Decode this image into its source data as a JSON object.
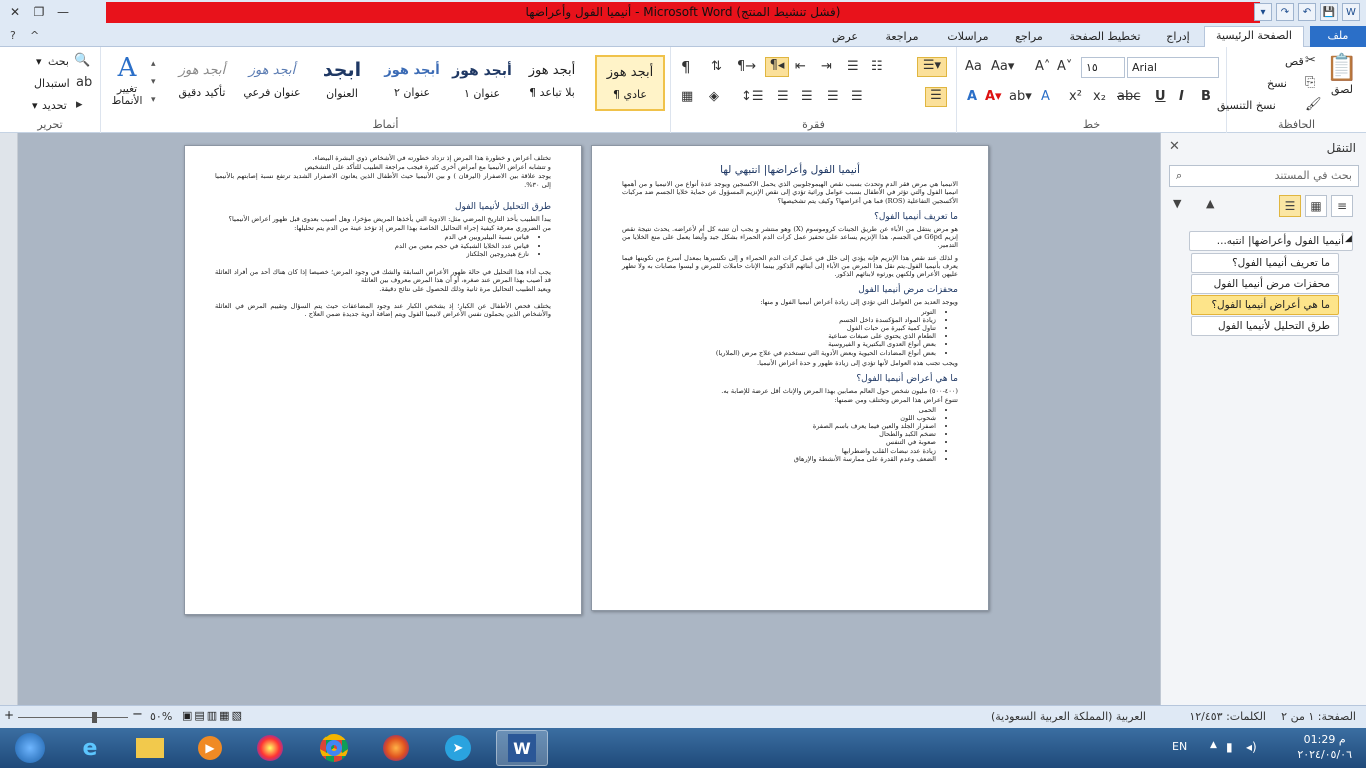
{
  "window": {
    "title": "أنيميا الفول وأعراضها - Microsoft Word (فشل تنشيط المنتج)",
    "controls": {
      "close": "✕",
      "restore": "❐",
      "minimize": "—"
    },
    "qat": [
      "W",
      "💾",
      "↶",
      "↷",
      "▾"
    ]
  },
  "tabs": {
    "file": "ملف",
    "home": "الصفحة الرئيسية",
    "insert": "إدراج",
    "layout": "تخطيط الصفحة",
    "references": "مراجع",
    "mailings": "مراسلات",
    "review": "مراجعة",
    "view": "عرض"
  },
  "ribbon": {
    "clipboard": {
      "label": "الحافظة",
      "paste": "لصق",
      "cut": "قص",
      "copy": "نسخ",
      "format_painter": "نسخ التنسيق"
    },
    "font": {
      "label": "خط",
      "name": "Arial",
      "size": "١٥"
    },
    "paragraph": {
      "label": "فقرة"
    },
    "styles": {
      "label": "أنماط",
      "items": [
        {
          "sample": "أبجد هوز",
          "name": "¶ عادي"
        },
        {
          "sample": "أبجد هوز",
          "name": "¶ بلا تباعد"
        },
        {
          "sample": "أبجد هوز",
          "name": "عنوان ١"
        },
        {
          "sample": "أبجد هوز",
          "name": "عنوان ٢"
        },
        {
          "sample": "ابجد",
          "name": "العنوان"
        },
        {
          "sample": "أبجد هوز",
          "name": "عنوان فرعي"
        },
        {
          "sample": "أبجد هوز",
          "name": "تأكيد دقيق"
        }
      ],
      "change_styles": "تغيير الأنماط"
    },
    "editing": {
      "label": "تحرير",
      "find": "بحث",
      "replace": "استبدال",
      "select": "تحديد"
    }
  },
  "page1": {
    "title": "أنيميا الفول وأعراضها| انتبهي لها",
    "intro": "الانيميا هي مرض فقر الدم وتحدث بسبب نقص الهيموجلوبين الذي يحمل الاكسجين ويوجد عدة أنواع من الانيميا و من أهمها انيميا الفول والتي تؤثر في الأطفال بسبب عوامل وراثية تؤدي إلى نقص الإنزيم المسؤول عن حماية خلايا الجسم ضد مركبات الأكسجين التفاعلية (ROS) فما هي أعراضها؟ وكيف يتم تشخيصها؟",
    "h_def": "ما تعريف أنيميا الفول؟",
    "p_def1": "هو مرض ينتقل من الأباء عن طريق الجينات كروموسوم (X) وهو منتشر و يجب أن تنتبه كل أم لأعراضه. يحدث نتيجة نقص إنزيم G6pd في الجسم. هذا الإنزيم يساعد على تحفيز عمل كرات الدم الحمراء بشكل جيد وأيضا يعمل على منع الخلايا من التدمير.",
    "p_def2": "و لذلك عند نقص هذا الإنزيم فإنه يؤدي إلى خلل في عمل كرات الدم الحمراء و إلى تكسيرها بمعدل أسرع من تكوينها فيما يعرف بأنيميا الفول.يتم نقل هذا المرض من الأباء إلى أبنائهم الذكور بينما الإناث حاملات للمرض و ليسوا مصابات به ولا تظهر عليهن الأعراض ولكنهن يورثوه لابنائهم الذكور.",
    "h_risk": "محفزات مرض أنيميا الفول",
    "p_risk": "ويوجد العديد من العوامل التي تؤدي إلى زيادة أعراض أنيميا الفول و منها:",
    "risk_items": [
      "التوتر",
      "زيادة المواد المؤكسدة داخل الجسم",
      "تناول كمية كبيرة من حبات الفول",
      "الطعام الذي يحتوي على صبغات صناعية",
      "بعض أنواع العدوى البكتيرية و الفيروسية",
      "بعض أنواع المضادات الحيوية وبعض الأدوية التي تستخدم في علاج مرض (الملاريا)"
    ],
    "p_risk_end": "ويجب تجنب هذه العوامل لأنها تؤدي إلى زيادة ظهور و حدة أعراض الأنيميا.",
    "h_symp": "ما هي أعراض أنيميا الفول؟",
    "p_symp1": "(٤٠٠-٥٠٠) مليون شخص حول العالم مصابين بهذا المرض والإناث أقل عرضة للإصابة به.",
    "p_symp2": "تتنوع أعراض هذا المرض وتختلف ومن ضمنها:",
    "symp_items": [
      "الحمى",
      "شحوب اللون",
      "اصفرار الجلد والعين فيما يعرف باسم الصفرة",
      "تضخم الكبد والطحال",
      "صعوبة في التنفس",
      "زيادة عدد نبضات القلب واضطرابها",
      "الضعف وعدم القدرة على ممارسة الأنشطة والإرهاق"
    ]
  },
  "page2": {
    "p1": "تختلف أعراض و خطورة هذا المرض إذ تزداد خطورته في الأشخاص ذوي البشرة البيضاء.",
    "p2": "و تتشابه أعراض الأنيميا مع أمراض أخرى كثيرة فيجب مراجعة الطبيب للتأكد على التشخيص",
    "p3": "يوجد علاقة بين الاصفرار (اليرقان ) و بين الأنيميا حيث الأطفال الذين يعانون الاصفرار الشديد ترتفع نسبة إصابتهم بالأنيميا إلى ٣٠%.",
    "h_diag": "طرق التحليل لأنيميا الفول",
    "p_diag1": "يبدأ الطبيب بأخذ التاريخ المرضي مثل: الادوية التي يأخذها المريض مؤخرا، وهل أصيب بعدوى قبل ظهور أعراض الأنيميا؟",
    "p_diag2": "من الضروري معرفة كيفية إجراء التحاليل الخاصة بهذا المرض إذ تؤخذ عينة من الدم يتم تحليلها:",
    "diag_items": [
      "قياس نسبة البيليروبين في الدم",
      "قياس عدد الخلايا الشبكية في حجم معين من الدم",
      "نازع هيدروجين الجلكتاز"
    ],
    "p_diag3": "يجب أداء هذا التحليل في حالة ظهور الأعراض السابقة والشك في وجود المرض؛ خصيصا إذا كان هناك أحد من أفراد العائلة قد أصيب بهذا المرض عند صغره، أو أن هذا المرض معروف بين العائلة",
    "p_diag4": "ويعيد الطبيب التحاليل مرة ثانية وذلك للحصول على نتائج دقيقة.",
    "p_diag5": "يختلف فحص الأطفال عن الكبار؛ إذ يشخص الكبار عند وجود المضاعفات حيث يتم السؤال وتقييم المرض في العائلة والأشخاص الذين يحملون نفس الأعراض لانيميا الفول ويتم إضافة أدوية جديدة ضمن العلاج ."
  },
  "nav": {
    "title": "التنقل",
    "search_placeholder": "بحث في المستند",
    "items": [
      {
        "label": "أنيميا الفول وأعراضها| انتبه...",
        "level": 1
      },
      {
        "label": "ما تعريف أنيميا الفول؟",
        "level": 2
      },
      {
        "label": "محفزات مرض أنيميا الفول",
        "level": 2
      },
      {
        "label": "ما هي أعراض أنيميا الفول؟",
        "level": 2,
        "selected": true
      },
      {
        "label": "طرق التحليل لأنيميا الفول",
        "level": 2
      }
    ]
  },
  "status": {
    "page": "الصفحة: ١ من ٢",
    "words": "الكلمات: ١٢/٤٥٣",
    "language": "العربية (المملكة العربية السعودية)",
    "zoom": "٥٠%"
  },
  "taskbar": {
    "lang": "EN",
    "time": "01:29 م",
    "date": "٢٠٢٤/٠٥/٠٦"
  },
  "colors": {
    "accent": "#2b6fc8",
    "title_bar_alert": "#e8121b",
    "heading": "#1f3864",
    "nav_selected": "#fde48a"
  }
}
